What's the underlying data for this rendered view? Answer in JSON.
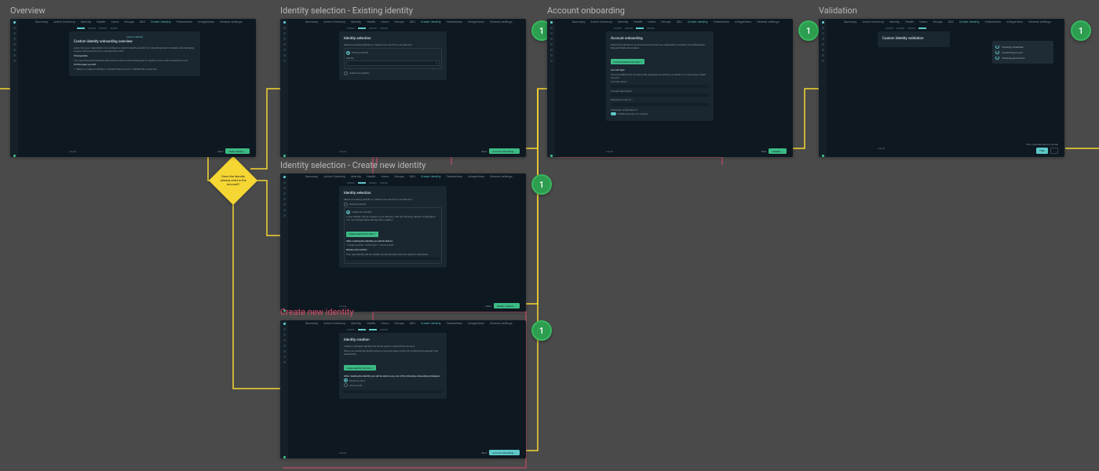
{
  "frames": {
    "overview": {
      "label": "Overview",
      "title": "Custom identity onboarding overview",
      "cta": "Select identity →",
      "cancel": "Cancel",
      "back": "← Back"
    },
    "identity_existing": {
      "label": "Identity selection - Existing identity",
      "title": "Identity selection",
      "cta": "Account onboarding →",
      "cancel": "Cancel",
      "back": "← Back"
    },
    "identity_new": {
      "label": "Identity selection - Create new identity",
      "title": "Identity selection",
      "cta": "Identity creation →",
      "cancel": "Cancel",
      "back": "← Back"
    },
    "create_identity": {
      "label": "Create new identity",
      "title": "Identity creation",
      "cta": "Account onboarding →",
      "cancel": "Cancel",
      "back": "← Back"
    },
    "account_onboarding": {
      "label": "Account onboarding",
      "title": "Account onboarding",
      "cta": "Validate →",
      "cancel": "Cancel",
      "back": "← Back",
      "btn_inline": "Connect external account ↗"
    },
    "validation": {
      "label": "Validation",
      "title": "Custom identity validation",
      "cancel": "Cancel",
      "statuses": [
        "Checking credentials",
        "Connecting account",
        "Checking permissions"
      ],
      "status_label": "This could take about a minute",
      "mini": "Hide"
    }
  },
  "topnav": [
    "Summary",
    "Active Directory",
    "Identity",
    "Health",
    "Users",
    "Groups",
    "SSO",
    "Create Identity",
    "Federations",
    "Integrations",
    "General settings"
  ],
  "topnav_active_index": 7,
  "overview_body": {
    "intro": "Learn how your organization can configure a custom identity provider for onboarding team members and managing access control across your connected accounts.",
    "prereq_label": "Prerequisites",
    "prereq_body": "You must have administrative permissions and an active billing plan to create or link a custom identity source.",
    "steps_label": "On this page you will:",
    "steps": "1. Select or create an identity  2. Onboard the account  3. Validate the connection"
  },
  "identity_form": {
    "intro": "Select an existing identity or create a new one from your directory.",
    "radio_existing": "Existing identity",
    "radio_new": "Create new identity",
    "identity_label": "Identity",
    "search_placeholder": "Search your identities"
  },
  "identity_new_form": {
    "intro": "Select an existing identity or create a new one from your directory.",
    "radio_existing": "Existing identity",
    "radio_new": "Create new identity",
    "note": "A new identity will be created in your directory with the following default configuration. You can change these settings after creation.",
    "btn": "Create identity first time ↗",
    "bullets_label": "After creating the identity you will be able to:",
    "bullets": "• Assign policies  • Invite users  • Link accounts",
    "review_label": "Review and confirm",
    "review_body": "Your new identity will be created we will securely store the required credentials."
  },
  "create_form": {
    "intro": "Create a managed identity that will be used to onboard this account.",
    "note": "When you create the identity below, a one-time setup script will configure the required trust relationship.",
    "btn": "Create identity first time ↗",
    "after_label": "After creating the identity you will be able to use one of the following onboarding strategies:",
    "opts": [
      "Single account",
      "All accounts"
    ]
  },
  "onboard_form": {
    "intro": "Attach this identity to an account and choose how organization members will authenticate. Required fields are marked.",
    "type_label": "Account type",
    "type_body": "Choose whether this should be the organization's primary connection or a secondary linked account.",
    "name_label": "Account name *",
    "desc_label": "Account description",
    "ext_label": "External account ID *",
    "adv_label": "Advanced configuration ▾",
    "toggle_label": "Enable auto-sync on connect"
  },
  "decision": {
    "text": "Does the identity already exist in the account?"
  },
  "badge_label": "1"
}
